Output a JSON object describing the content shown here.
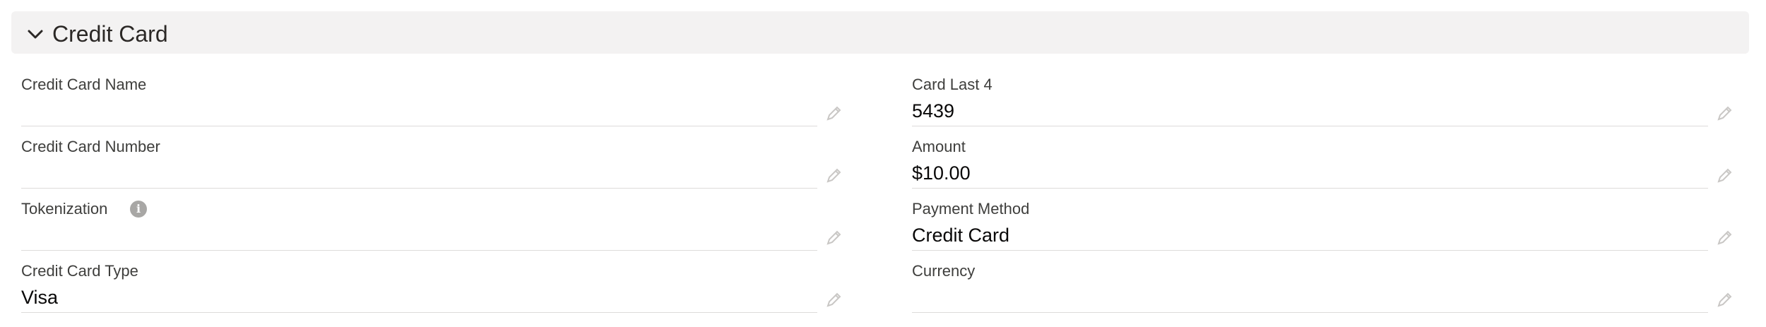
{
  "section": {
    "title": "Credit Card"
  },
  "left_fields": [
    {
      "label": "Credit Card Name",
      "value": ""
    },
    {
      "label": "Credit Card Number",
      "value": ""
    },
    {
      "label": "Tokenization",
      "value": ""
    },
    {
      "label": "Credit Card Type",
      "value": "Visa"
    }
  ],
  "right_fields": [
    {
      "label": "Card Last 4",
      "value": "5439"
    },
    {
      "label": "Amount",
      "value": "$10.00"
    },
    {
      "label": "Payment Method",
      "value": "Credit Card"
    },
    {
      "label": "Currency",
      "value": ""
    }
  ],
  "icons": {
    "collapse": "chevron-down-icon",
    "edit": "pencil-icon",
    "help": "info-icon"
  },
  "colors": {
    "header_bg": "#f3f2f2",
    "label": "#3e3e3c",
    "value": "#080707",
    "divider": "#dddbda",
    "icon": "#c9c7c5"
  }
}
